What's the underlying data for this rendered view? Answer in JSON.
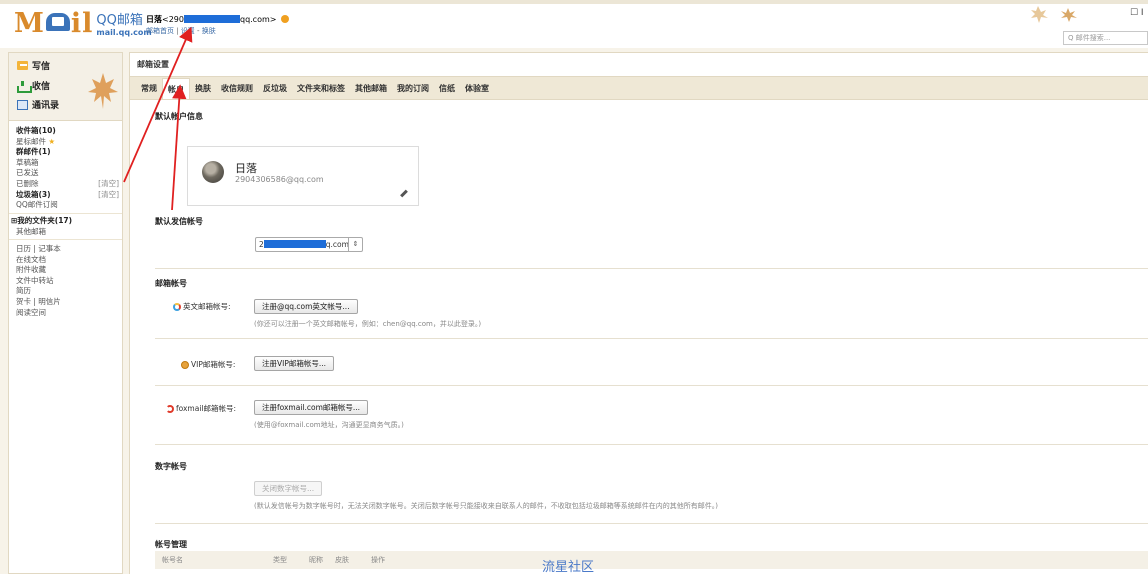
{
  "header": {
    "logo_big": "Mil",
    "logo_cn": "QQ邮箱",
    "logo_url": "mail.qq.com",
    "user_name": "日落",
    "user_email_prefix": "<290",
    "user_email_suffix": "qq.com>",
    "link_home": "邮箱首页",
    "link_sep": " | ",
    "link_settings": "设置",
    "link_skin_sep": " - ",
    "link_skin": "换肤",
    "search_placeholder": "Q 邮件搜索...",
    "corner_icon": "☐ I"
  },
  "sidebar": {
    "write": "写信",
    "inbox": "收信",
    "contacts": "通讯录",
    "folders": [
      {
        "label": "收件箱(10)",
        "bold": true,
        "extra": ""
      },
      {
        "label": "星标邮件",
        "bold": false,
        "extra": "",
        "star": "★"
      },
      {
        "label": "群邮件(1)",
        "bold": true,
        "extra": ""
      },
      {
        "label": "草稿箱",
        "bold": false,
        "extra": ""
      },
      {
        "label": "已发送",
        "bold": false,
        "extra": ""
      },
      {
        "label": "已删除",
        "bold": false,
        "extra": "[清空]"
      },
      {
        "label": "垃圾箱(3)",
        "bold": true,
        "extra": "[清空]"
      },
      {
        "label": "QQ邮件订阅",
        "bold": false,
        "extra": ""
      }
    ],
    "my_folders": "⊞我的文件夹(17)",
    "other_mail": "其他邮箱",
    "apps": [
      "日历 | 记事本",
      "在线文档",
      "附件收藏",
      "文件中转站",
      "简历",
      "贺卡 | 明信片",
      "阅读空间"
    ]
  },
  "main": {
    "title": "邮箱设置",
    "tabs": [
      "常规",
      "帐户",
      "换肤",
      "收信规则",
      "反垃圾",
      "文件夹和标签",
      "其他邮箱",
      "我的订阅",
      "信纸",
      "体验室"
    ],
    "active_tab": 1,
    "default_account_title": "默认帐户信息",
    "card_name": "日落",
    "card_email": "2904306586@qq.com",
    "default_sender_title": "默认发信帐号",
    "sender_prefix": "2",
    "sender_suffix": "q.com",
    "sender_arrow": "⇕",
    "mail_accounts_title": "邮箱帐号",
    "english_label": "英文邮箱帐号:",
    "english_button": "注册@qq.com英文帐号...",
    "english_hint": "(你还可以注册一个英文邮箱帐号，例如：chen@qq.com，并以此登录。)",
    "vip_label": "VIP邮箱帐号:",
    "vip_button": "注册VIP邮箱帐号...",
    "foxmail_label": "foxmail邮箱帐号:",
    "foxmail_button": "注册foxmail.com邮箱帐号...",
    "foxmail_hint": "(使用@foxmail.com地址，沟通更显商务气质。)",
    "digital_title": "数字帐号",
    "digital_button": "关闭数字帐号...",
    "digital_hint": "(默认发信帐号为数字帐号时，无法关闭数字帐号。关闭后数字帐号只能接收来自联系人的邮件，不收取包括垃圾邮箱等系统邮件在内的其他所有邮件。)",
    "manage_title": "帐号管理",
    "table_headers": [
      "帐号名",
      "类型",
      "昵称",
      "皮肤",
      "操作"
    ]
  },
  "watermark": "流星社区"
}
